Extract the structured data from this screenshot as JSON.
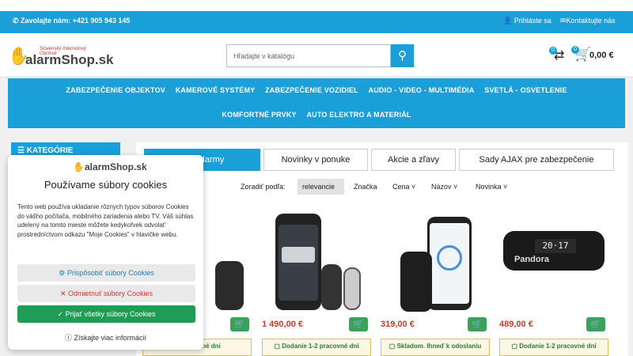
{
  "topbar": {
    "phone": "Zavolajte nám: +421 905 943 145",
    "login": "Prihláste sa",
    "contact": "Kontaktujte nás"
  },
  "logo": {
    "name": "alarmShop.sk",
    "slogan": "Slovenský Internetový Obchod"
  },
  "search": {
    "placeholder": "Hľadajte v katalógu"
  },
  "header_icons": {
    "compare_count": "0",
    "cart_count": "0",
    "cart_total": "0,00 €"
  },
  "nav": {
    "row1": [
      "ZABEZPEČENIE OBJEKTOV",
      "KAMEROVÉ SYSTÉMY",
      "ZABEZPEČENIE VOZIDIEL",
      "AUDIO - VIDEO - MULTIMÉDIA",
      "SVETLÁ - OSVETLENIE"
    ],
    "row2": [
      "KOMFORTNÉ PRVKY",
      "AUTO ELEKTRO A MATERIÁL"
    ]
  },
  "sidebar": {
    "categories_label": "KATEGÓRIE"
  },
  "tabs": [
    "Autoalarmy",
    "Novinky v ponuke",
    "Akcie a zľavy",
    "Sady AJAX pre zabezpečenie"
  ],
  "sort": {
    "label": "Zoradiť podľa:",
    "options": [
      "relevancie",
      "Značka",
      "Cena",
      "Názov",
      "Novinka"
    ]
  },
  "products": [
    {
      "price": "",
      "stock": "pracovné dni"
    },
    {
      "price": "1 490,00 €",
      "stock": "Dodanie 1-2 pracovné dni"
    },
    {
      "price": "319,00 €",
      "stock": "Skladom. Ihneď k odoslaniu"
    },
    {
      "price": "489,00 €",
      "stock": "Dodanie 1-2 pracovné dni"
    }
  ],
  "pandora_label": "Pandora",
  "fob_display": "20·17",
  "cookies": {
    "logo": "alarmShop.sk",
    "title": "Používame súbory cookies",
    "description": "Tento web používa ukladanie rôznych typov súborov Cookies do vášho počítača, mobilného zariadenia alebo TV. Váš súhlas udelený na tomto mieste môžete kedykoľvek odvolať prostredníctvom odkazu \"Moje Cookies\" v hlavičke webu.",
    "customize": "Prispôsobiť súbory Cookies",
    "reject": "Odmietnuť súbory Cookies",
    "accept": "Prijať všetky súbory Cookies",
    "more": "Získajte viac informácií"
  },
  "colors": {
    "primary": "#1a9fd8",
    "price": "#d8352a",
    "accept": "#1f9d55",
    "reject": "#d8352a"
  }
}
